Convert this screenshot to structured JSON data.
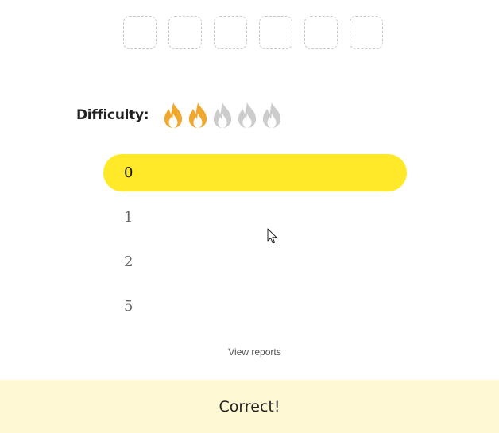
{
  "answer_slots": {
    "count": 6
  },
  "difficulty": {
    "label": "Difficulty:",
    "rating": 2,
    "max": 5,
    "icon": "flame-icon",
    "active_color": "#f0a82e",
    "inactive_color": "#cccccc"
  },
  "options": [
    {
      "label": "0",
      "selected": true
    },
    {
      "label": "1",
      "selected": false
    },
    {
      "label": "2",
      "selected": false
    },
    {
      "label": "5",
      "selected": false
    }
  ],
  "highlight_color": "#ffe929",
  "view_reports_label": "View reports",
  "result": {
    "text": "Correct!",
    "background": "#fff8d5"
  }
}
